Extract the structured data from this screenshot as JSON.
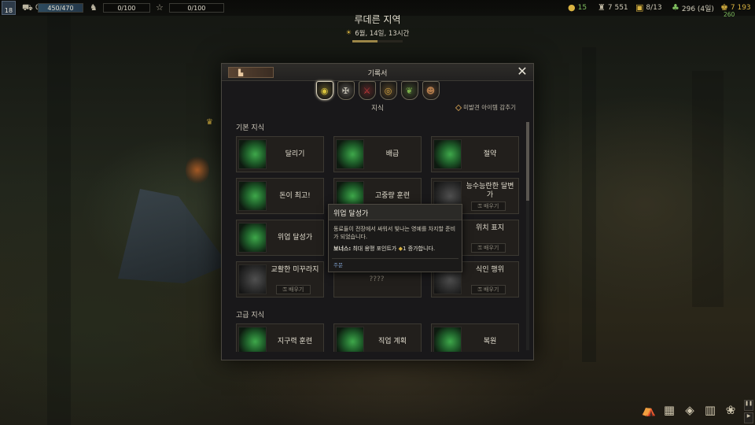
{
  "topbar": {
    "level": "18",
    "troops": "0",
    "health": "450/470",
    "horse_value": "0/100",
    "renown_value": "0/100",
    "stat_green": "15",
    "stat_men": "7 551",
    "stat_party": "8/13",
    "stat_food": "296 (4일)",
    "stat_gold": "7 193",
    "stat_gold_delta": "260"
  },
  "location": {
    "name": "루데른 지역",
    "date": "6월, 14일, 13시간",
    "day_progress": 0.5
  },
  "dialog": {
    "title": "기록서",
    "section": "지식",
    "hide_label": "미발견 아이템 감추기",
    "tabs": [
      {
        "name": "shield-tab",
        "glyph": "◉",
        "color": "#d8c23c"
      },
      {
        "name": "tools-tab",
        "glyph": "✠",
        "color": "#c8c4b6"
      },
      {
        "name": "weapons-tab",
        "glyph": "⚔",
        "color": "#c43a3a"
      },
      {
        "name": "helmet-tab",
        "glyph": "◎",
        "color": "#d0a042"
      },
      {
        "name": "herb-tab",
        "glyph": "❦",
        "color": "#7cb04a"
      },
      {
        "name": "head-tab",
        "glyph": "☻",
        "color": "#b07a4a"
      }
    ],
    "basic_label": "기본 지식",
    "advanced_label": "고급 지식",
    "learn_label": "배우기",
    "basic": [
      {
        "label": "달리기",
        "state": "learned"
      },
      {
        "label": "배급",
        "state": "learned"
      },
      {
        "label": "절약",
        "state": "learned"
      },
      {
        "label": "돈이 최고!",
        "state": "learned"
      },
      {
        "label": "고중량 훈련",
        "state": "learned"
      },
      {
        "label": "능수능란한 달변가",
        "state": "locked"
      },
      {
        "label": "위업 달성가",
        "state": "learned"
      },
      {
        "label": "",
        "state": "hidden"
      },
      {
        "label": "위치 표지",
        "state": "locked"
      },
      {
        "label": "교활한 미꾸라지",
        "state": "locked"
      },
      {
        "label": "????",
        "state": "unknown"
      },
      {
        "label": "식인 행위",
        "state": "locked"
      }
    ],
    "advanced": [
      {
        "label": "지구력 훈련",
        "state": "learned"
      },
      {
        "label": "직업 계획",
        "state": "learned"
      },
      {
        "label": "복원",
        "state": "learned"
      }
    ]
  },
  "tooltip": {
    "title": "위업 달성가",
    "desc": "동료들이 전장에서 싸워서 빛나는 영예를 차지할 준비가 되었습니다.",
    "bonus_label": "보너스:",
    "bonus_text": "최대 용맹 포인트가",
    "bonus_value": "1",
    "bonus_suffix": "증가합니다.",
    "footer": "주문"
  },
  "colors": {
    "accent_green": "#3ea84a",
    "gold": "#d9b341",
    "link_blue": "#7fa2d0"
  }
}
